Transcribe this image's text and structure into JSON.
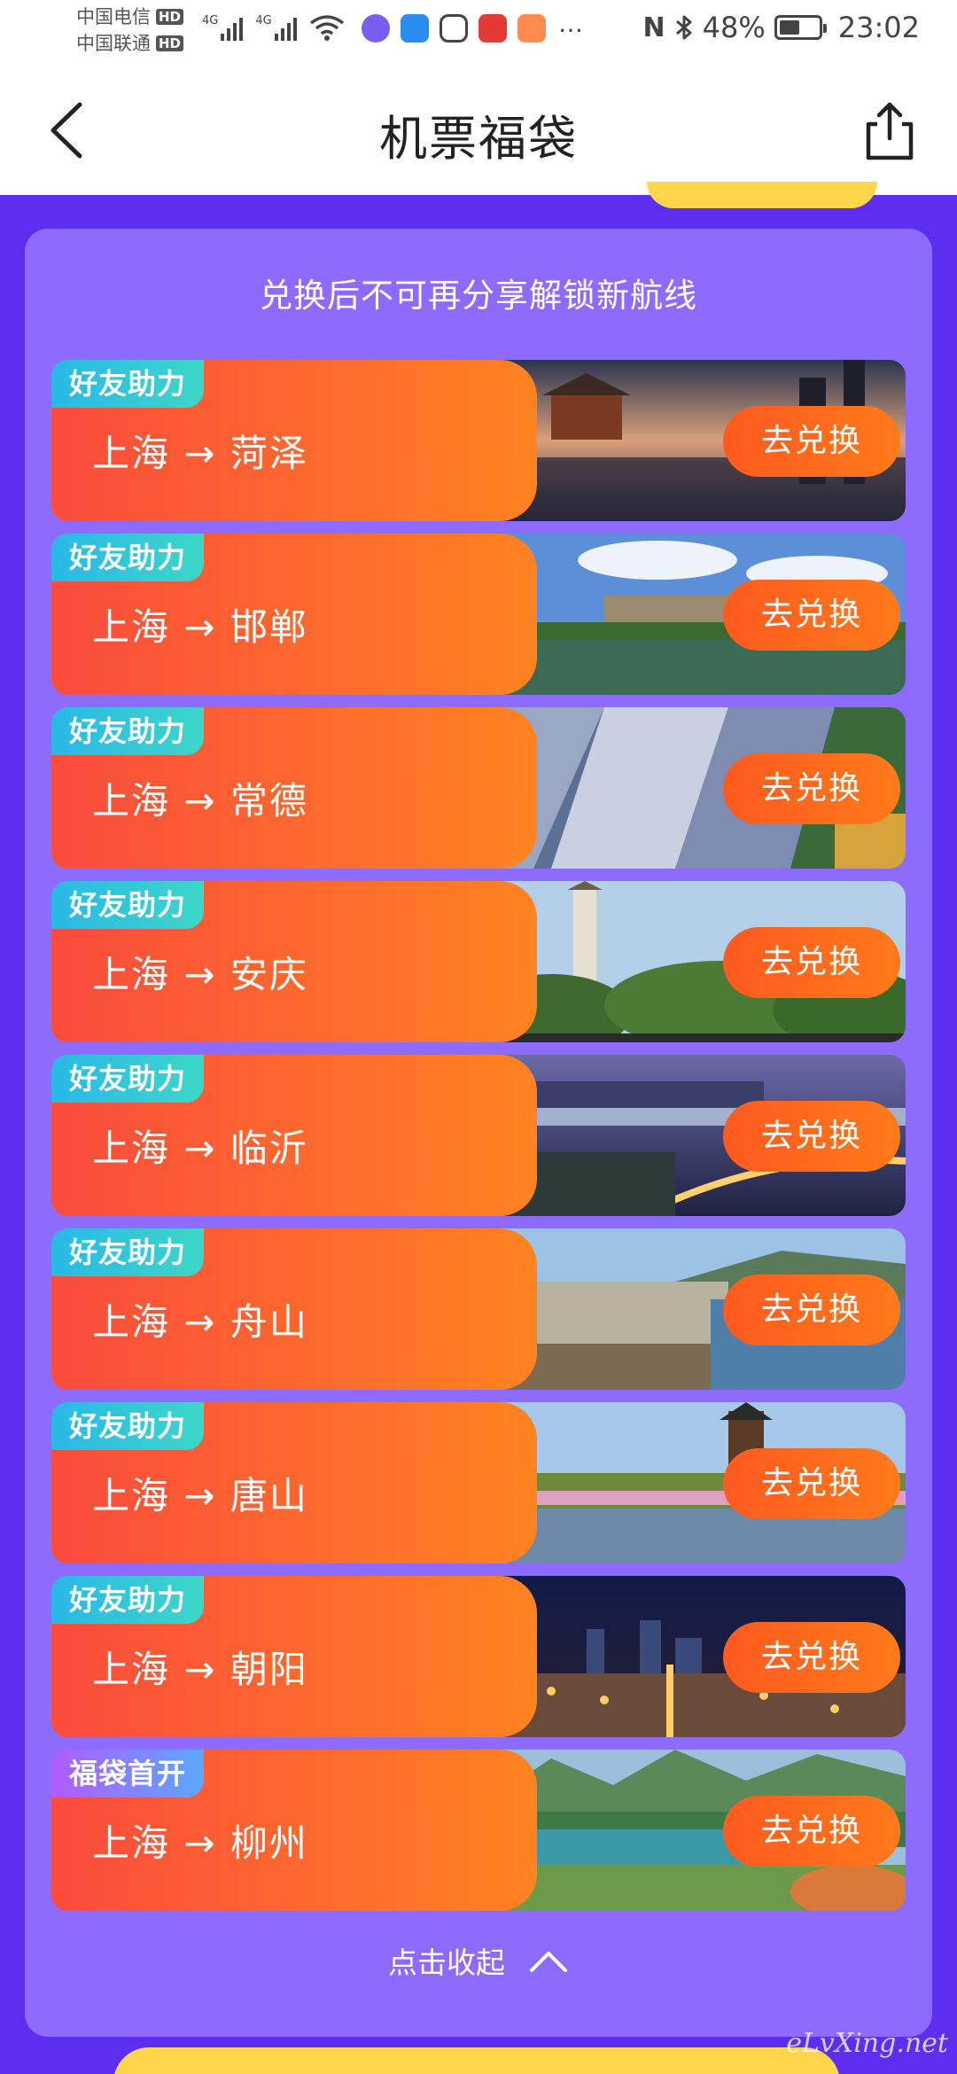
{
  "status_bar": {
    "carrier_1": "中国电信",
    "carrier_2": "中国联通",
    "hd_badge": "HD",
    "network_1": "4G",
    "network_2": "4G",
    "battery": "48%",
    "time": "23:02",
    "more": "…",
    "nfc_label": "N"
  },
  "nav": {
    "title": "机票福袋"
  },
  "panel": {
    "title": "兑换后不可再分享解锁新航线",
    "collapse_label": "点击收起"
  },
  "routes": [
    {
      "tag": "好友助力",
      "route": "上海 → 菏泽",
      "button": "去兑换",
      "image": "pavilion-sunset"
    },
    {
      "tag": "好友助力",
      "route": "上海 → 邯郸",
      "button": "去兑换",
      "image": "city-wall-lake"
    },
    {
      "tag": "好友助力",
      "route": "上海 → 常德",
      "button": "去兑换",
      "image": "basalt-columns"
    },
    {
      "tag": "好友助力",
      "route": "上海 → 安庆",
      "button": "去兑换",
      "image": "pagoda"
    },
    {
      "tag": "好友助力",
      "route": "上海 → 临沂",
      "button": "去兑换",
      "image": "night-bridge"
    },
    {
      "tag": "好友助力",
      "route": "上海 → 舟山",
      "button": "去兑换",
      "image": "island-harbor"
    },
    {
      "tag": "好友助力",
      "route": "上海 → 唐山",
      "button": "去兑换",
      "image": "tower-park"
    },
    {
      "tag": "好友助力",
      "route": "上海 → 朝阳",
      "button": "去兑换",
      "image": "city-night"
    },
    {
      "tag": "福袋首开",
      "route": "上海 → 柳州",
      "button": "去兑换",
      "image": "river-mountains"
    }
  ],
  "watermark": "eLvXing.net",
  "colors": {
    "page_bg": "#5c2ff0",
    "panel_bg": "#8e6bff",
    "card_gradient_start": "#fa4b3d",
    "card_gradient_end": "#ff8320",
    "tag_friend": "#2dc6d8",
    "accent_yellow": "#ffd64a"
  }
}
